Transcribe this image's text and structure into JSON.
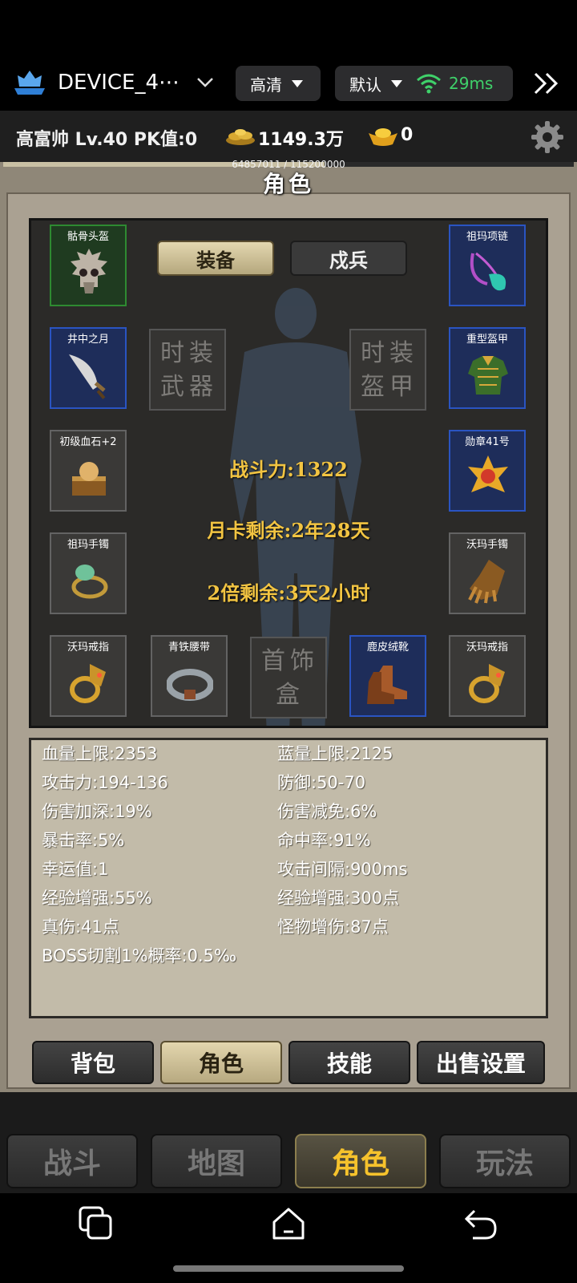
{
  "device": {
    "name": "DEVICE_4⋯",
    "quality_label": "高清",
    "line_label": "默认",
    "ping": "29ms"
  },
  "player": {
    "info": "高富帅  Lv.40  PK值:0",
    "gold": "1149.3万",
    "ingots": "0"
  },
  "exp": {
    "text": "64857011 / 115200000",
    "fraction": 0.563
  },
  "panel": {
    "title": "角色"
  },
  "equip_tabs": {
    "equip": "装备",
    "guard": "戍兵"
  },
  "slots": {
    "helmet": "骷骨头盔",
    "necklace": "祖玛项链",
    "weapon": "井中之月",
    "armor": "重型盔甲",
    "bloodstone": "初级血石+2",
    "medal": "勋章41号",
    "bracelet_left": "祖玛手镯",
    "bracelet_right": "沃玛手镯",
    "ring_left": "沃玛戒指",
    "belt": "青铁腰带",
    "boots": "鹿皮绒靴",
    "ring_right": "沃玛戒指"
  },
  "placeholders": {
    "fashion_weapon": "时装武器",
    "fashion_armor": "时装盔甲",
    "jewelry_box": "首饰盒"
  },
  "center": {
    "power": "战斗力:1322",
    "monthly": "月卡剩余:2年28天",
    "double": "2倍剩余:3天2小时"
  },
  "stats": {
    "left": [
      "血量上限:2353",
      "攻击力:194-136",
      "伤害加深:19%",
      "暴击率:5%",
      "幸运值:1",
      "经验增强:55%",
      "真伤:41点",
      "BOSS切割1%概率:0.5‰"
    ],
    "right": [
      "蓝量上限:2125",
      "防御:50-70",
      "伤害减免:6%",
      "命中率:91%",
      "攻击间隔:900ms",
      "经验增强:300点",
      "怪物增伤:87点"
    ]
  },
  "panel_tabs": [
    "背包",
    "角色",
    "技能",
    "出售设置"
  ],
  "nav_tabs": [
    "战斗",
    "地图",
    "角色",
    "玩法"
  ],
  "colors": {
    "accent_gold": "#f6c22c",
    "ping_green": "#3fd16a",
    "slot_blue": "#2a54c2",
    "slot_green": "#2e8a31"
  }
}
